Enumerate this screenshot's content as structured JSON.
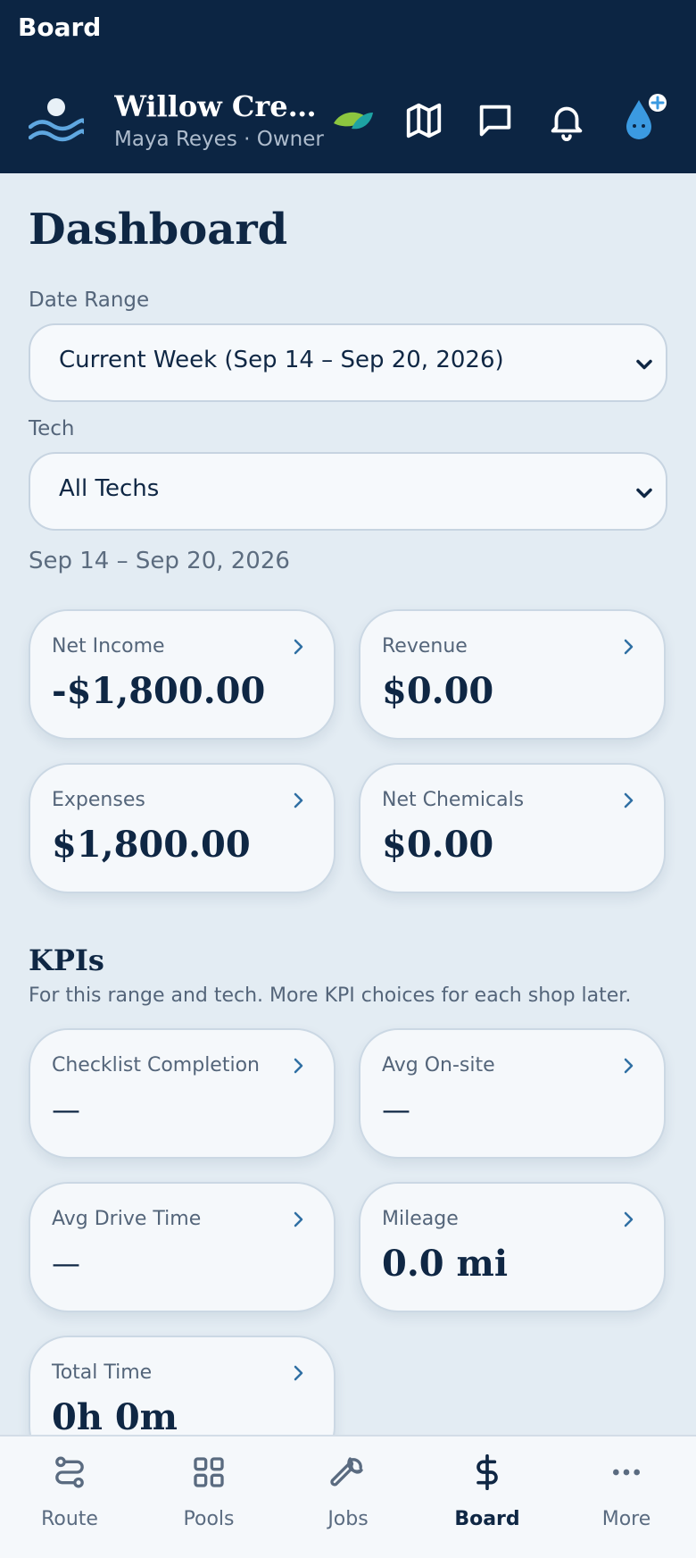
{
  "app": {
    "page_label": "Board"
  },
  "header": {
    "business_name": "Willow Cree…",
    "user_line": "Maya Reyes · Owner",
    "icons": [
      "leaf-icon",
      "map-icon",
      "chat-icon",
      "bell-icon",
      "water-drop-add-icon"
    ]
  },
  "dashboard": {
    "title": "Dashboard",
    "date_range_label": "Date Range",
    "date_range_value": "Current Week (Sep 14 – Sep 20, 2026)",
    "tech_label": "Tech",
    "tech_value": "All Techs",
    "range_text": "Sep 14 – Sep 20, 2026"
  },
  "finance_cards": [
    {
      "label": "Net Income",
      "value": "-$1,800.00"
    },
    {
      "label": "Revenue",
      "value": "$0.00"
    },
    {
      "label": "Expenses",
      "value": "$1,800.00"
    },
    {
      "label": "Net Chemicals",
      "value": "$0.00"
    }
  ],
  "kpis": {
    "title": "KPIs",
    "subtitle": "For this range and tech. More KPI choices for each shop later.",
    "cards": [
      {
        "label": "Checklist Completion",
        "value": "—"
      },
      {
        "label": "Avg On-site",
        "value": "—"
      },
      {
        "label": "Avg Drive Time",
        "value": "—"
      },
      {
        "label": "Mileage",
        "value": "0.0 mi"
      },
      {
        "label": "Total Time",
        "value": "0h 0m"
      }
    ]
  },
  "bottom_nav": {
    "items": [
      {
        "label": "Route",
        "icon": "route-icon"
      },
      {
        "label": "Pools",
        "icon": "grid-icon"
      },
      {
        "label": "Jobs",
        "icon": "wrench-icon"
      },
      {
        "label": "Board",
        "icon": "dollar-icon",
        "active": true
      },
      {
        "label": "More",
        "icon": "ellipsis-icon"
      }
    ]
  },
  "colors": {
    "header_bg": "#0c2543",
    "page_bg": "#e3ecf3",
    "card_bg": "#f5f8fb",
    "text_primary": "#0f2744",
    "accent": "#2f6fa3",
    "drop_blue": "#3b9ae1",
    "leaf_green": "#8cc63f"
  }
}
